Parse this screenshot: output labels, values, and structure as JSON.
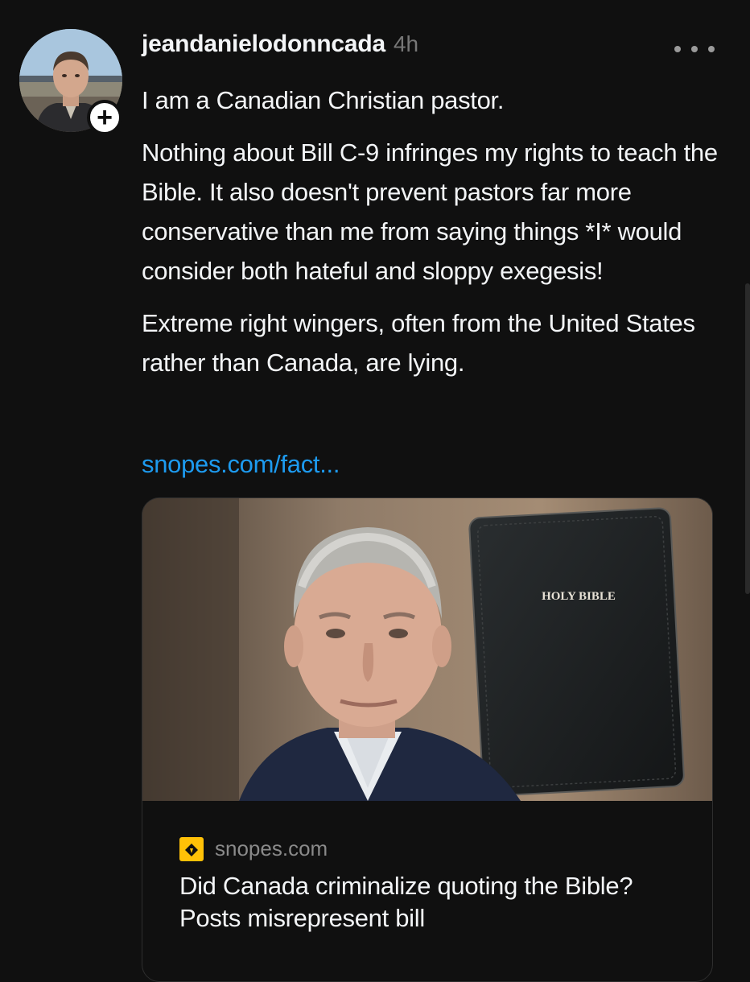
{
  "post": {
    "username": "jeandanielodonncada",
    "timestamp": "4h",
    "follow_label": "+",
    "more_icon": "more-horizontal-icon",
    "paragraphs": [
      "I am a Canadian Christian pastor.",
      "Nothing about Bill C-9 infringes my rights to teach the Bible. It also doesn't prevent pastors far more conservative than me from saying things *I* would consider both hateful and sloppy exegesis!",
      "Extreme right wingers, often from the United States rather than Canada, are lying."
    ],
    "link_text": "snopes.com/fact...",
    "card": {
      "image_text": "HOLY BIBLE",
      "source_icon": "snopes-logo-icon",
      "source": "snopes.com",
      "title": "Did Canada criminalize quoting the Bible? Posts misrepresent bill"
    }
  },
  "colors": {
    "background": "#101010",
    "text": "#f3f5f7",
    "muted": "#777777",
    "link": "#1d9bf0",
    "snopes_yellow": "#ffc107"
  }
}
